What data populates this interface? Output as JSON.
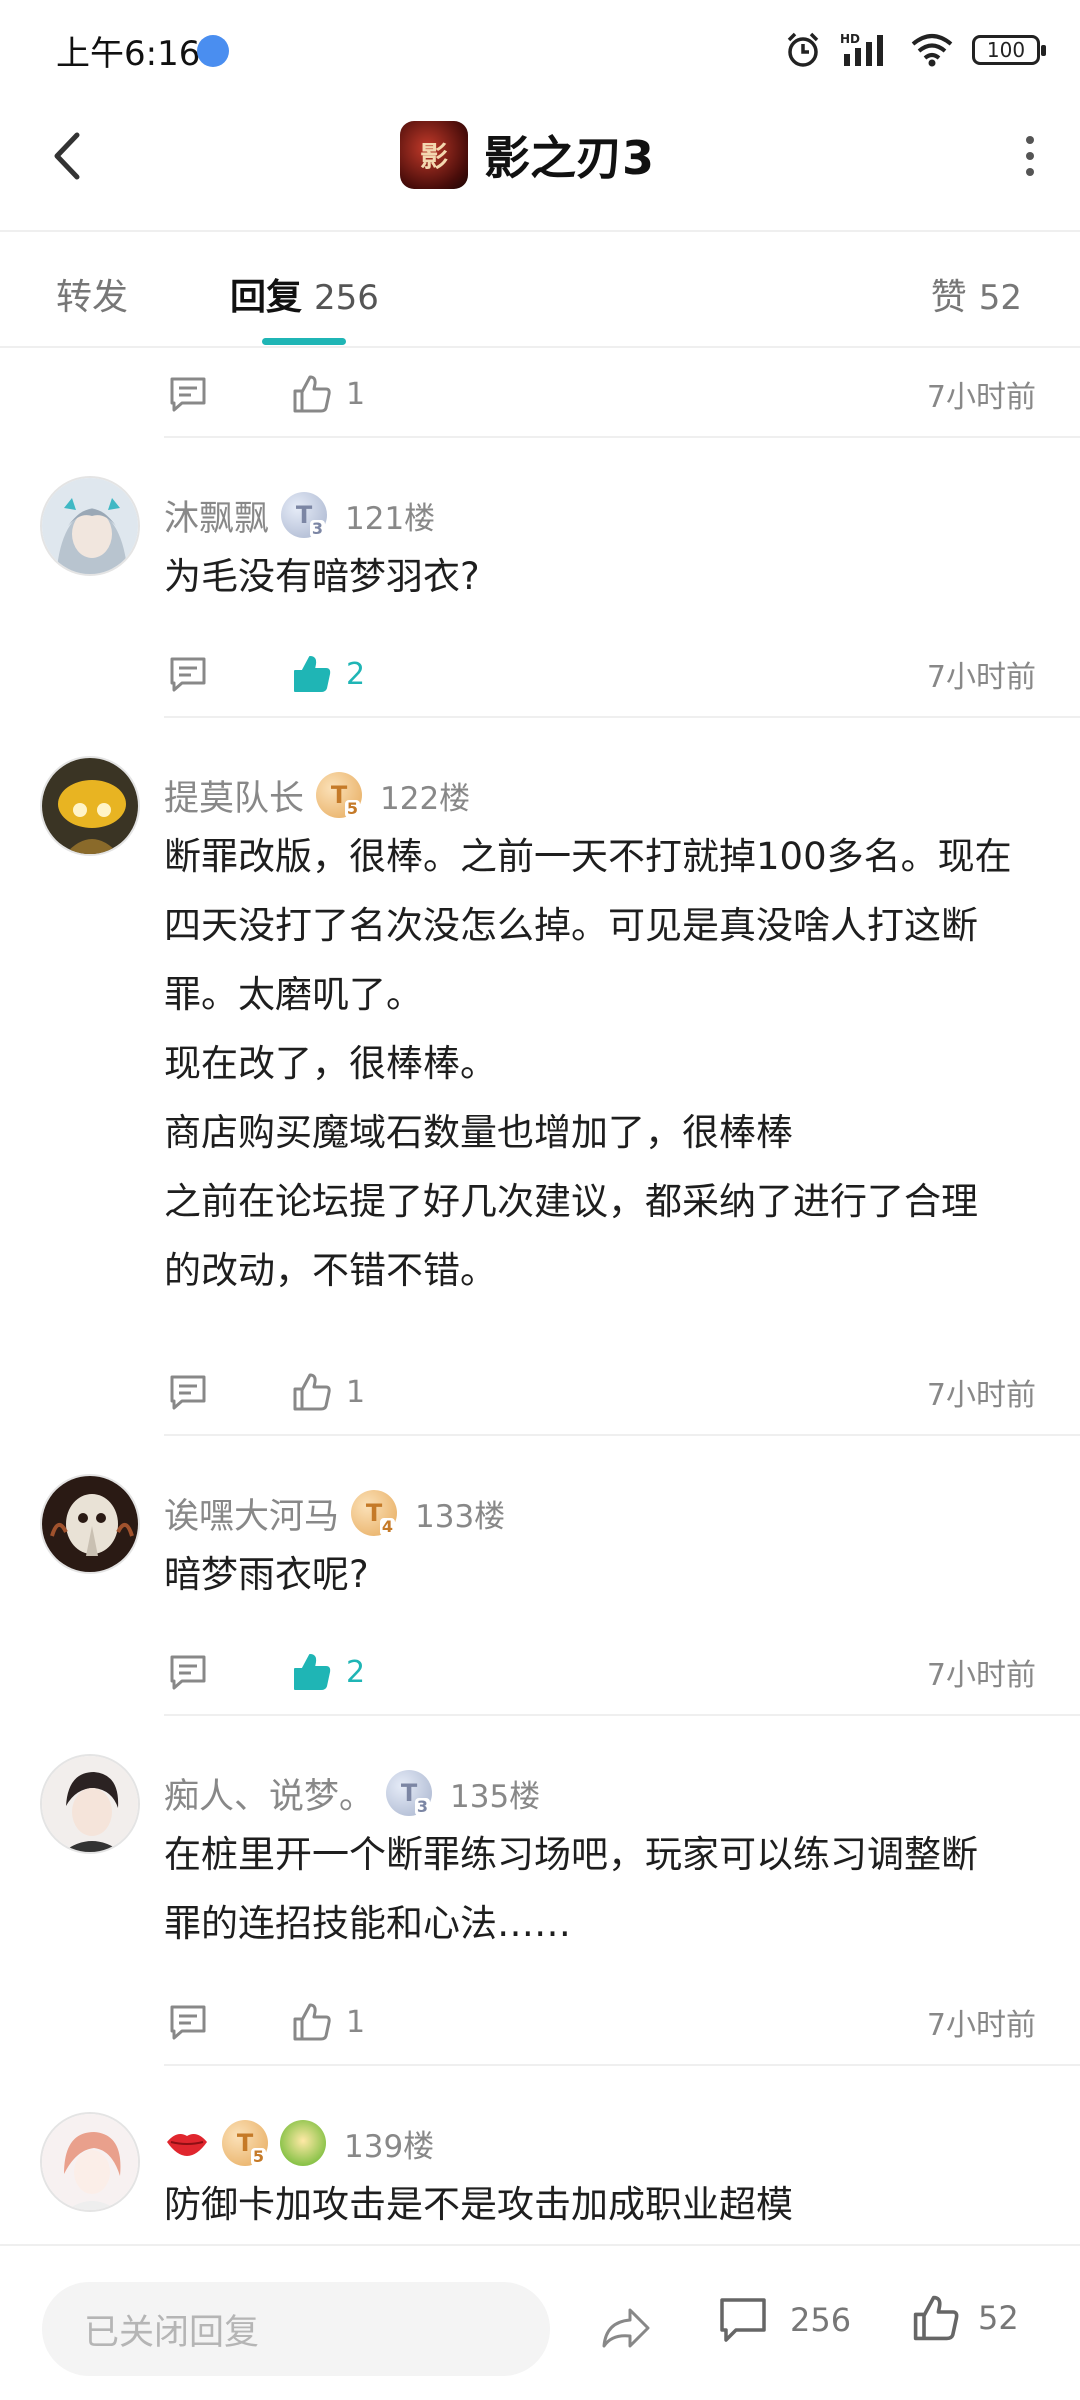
{
  "status_bar": {
    "time": "上午6:16",
    "battery": "100",
    "network_badge": "HD"
  },
  "header": {
    "title": "影之刃3",
    "logo_glyph": "影"
  },
  "tabs": {
    "forward_label": "转发",
    "reply_label": "回复",
    "reply_count": "256",
    "like_label": "赞",
    "like_count": "52"
  },
  "partial_post": {
    "likes": "1",
    "time": "7小时前"
  },
  "posts": [
    {
      "username": "沐飘飘",
      "badge": "T",
      "badge_level": "3",
      "floor": "121楼",
      "content": "为毛没有暗梦羽衣?",
      "likes": "2",
      "liked": true,
      "time": "7小时前"
    },
    {
      "username": "提莫队长",
      "badge": "T",
      "badge_level": "5",
      "floor": "122楼",
      "content": "断罪改版，很棒。之前一天不打就掉100多名。现在\n四天没打了名次没怎么掉。可见是真没啥人打这断\n罪。太磨叽了。\n现在改了，很棒棒。\n商店购买魔域石数量也增加了，很棒棒\n之前在论坛提了好几次建议，都采纳了进行了合理\n的改动，不错不错。",
      "likes": "1",
      "liked": false,
      "time": "7小时前"
    },
    {
      "username": "诶嘿大河马",
      "badge": "T",
      "badge_level": "4",
      "floor": "133楼",
      "content": "暗梦雨衣呢?",
      "likes": "2",
      "liked": true,
      "time": "7小时前"
    },
    {
      "username": "痴人、说梦。",
      "badge": "T",
      "badge_level": "3",
      "floor": "135楼",
      "content": "在桩里开一个断罪练习场吧，玩家可以练习调整断\n罪的连招技能和心法……",
      "likes": "1",
      "liked": false,
      "time": "7小时前"
    },
    {
      "username": "",
      "badge": "T",
      "badge_level": "5",
      "floor": "139楼",
      "content": "防御卡加攻击是不是攻击加成职业超模"
    }
  ],
  "bottom_bar": {
    "reply_placeholder": "已关闭回复",
    "comment_count": "256",
    "like_count": "52"
  },
  "colors": {
    "accent": "#1fb5b5",
    "muted_text": "#888888",
    "divider": "#efefef"
  },
  "icons": {
    "back": "chevron-left-icon",
    "more": "more-vertical-icon",
    "comment": "comment-icon",
    "like": "thumbs-up-icon",
    "share": "share-icon"
  }
}
